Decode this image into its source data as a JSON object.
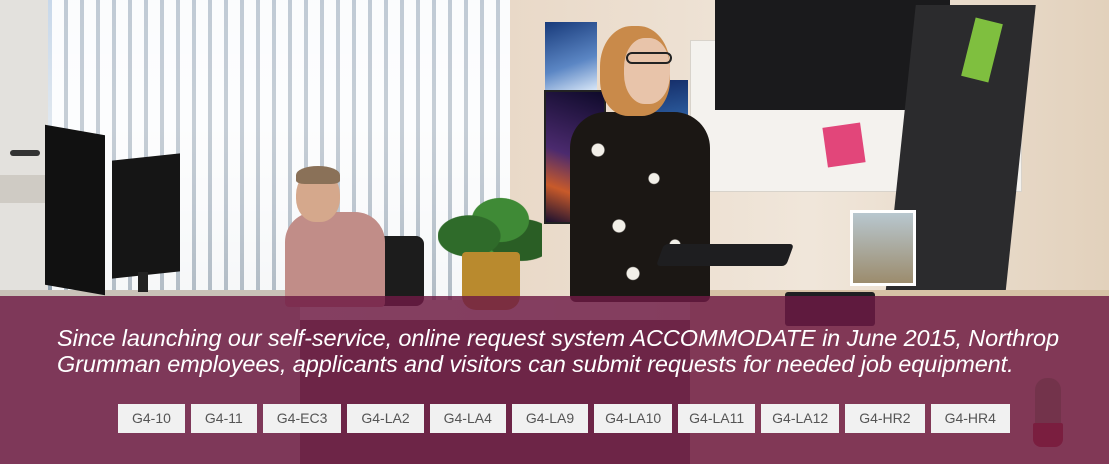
{
  "banner": {
    "caption": "Since launching our self-service, online request system ACCOMMODATE in June 2015, Northrop Grumman employees, applicants and visitors can submit requests for needed job equipment.",
    "overlay_color": "#6e1a44",
    "tags": [
      {
        "label": "G4-10"
      },
      {
        "label": "G4-11"
      },
      {
        "label": "G4-EC3"
      },
      {
        "label": "G4-LA2"
      },
      {
        "label": "G4-LA4"
      },
      {
        "label": "G4-LA9"
      },
      {
        "label": "G4-LA10"
      },
      {
        "label": "G4-LA11"
      },
      {
        "label": "G4-LA12"
      },
      {
        "label": "G4-HR2"
      },
      {
        "label": "G4-HR4"
      }
    ]
  }
}
